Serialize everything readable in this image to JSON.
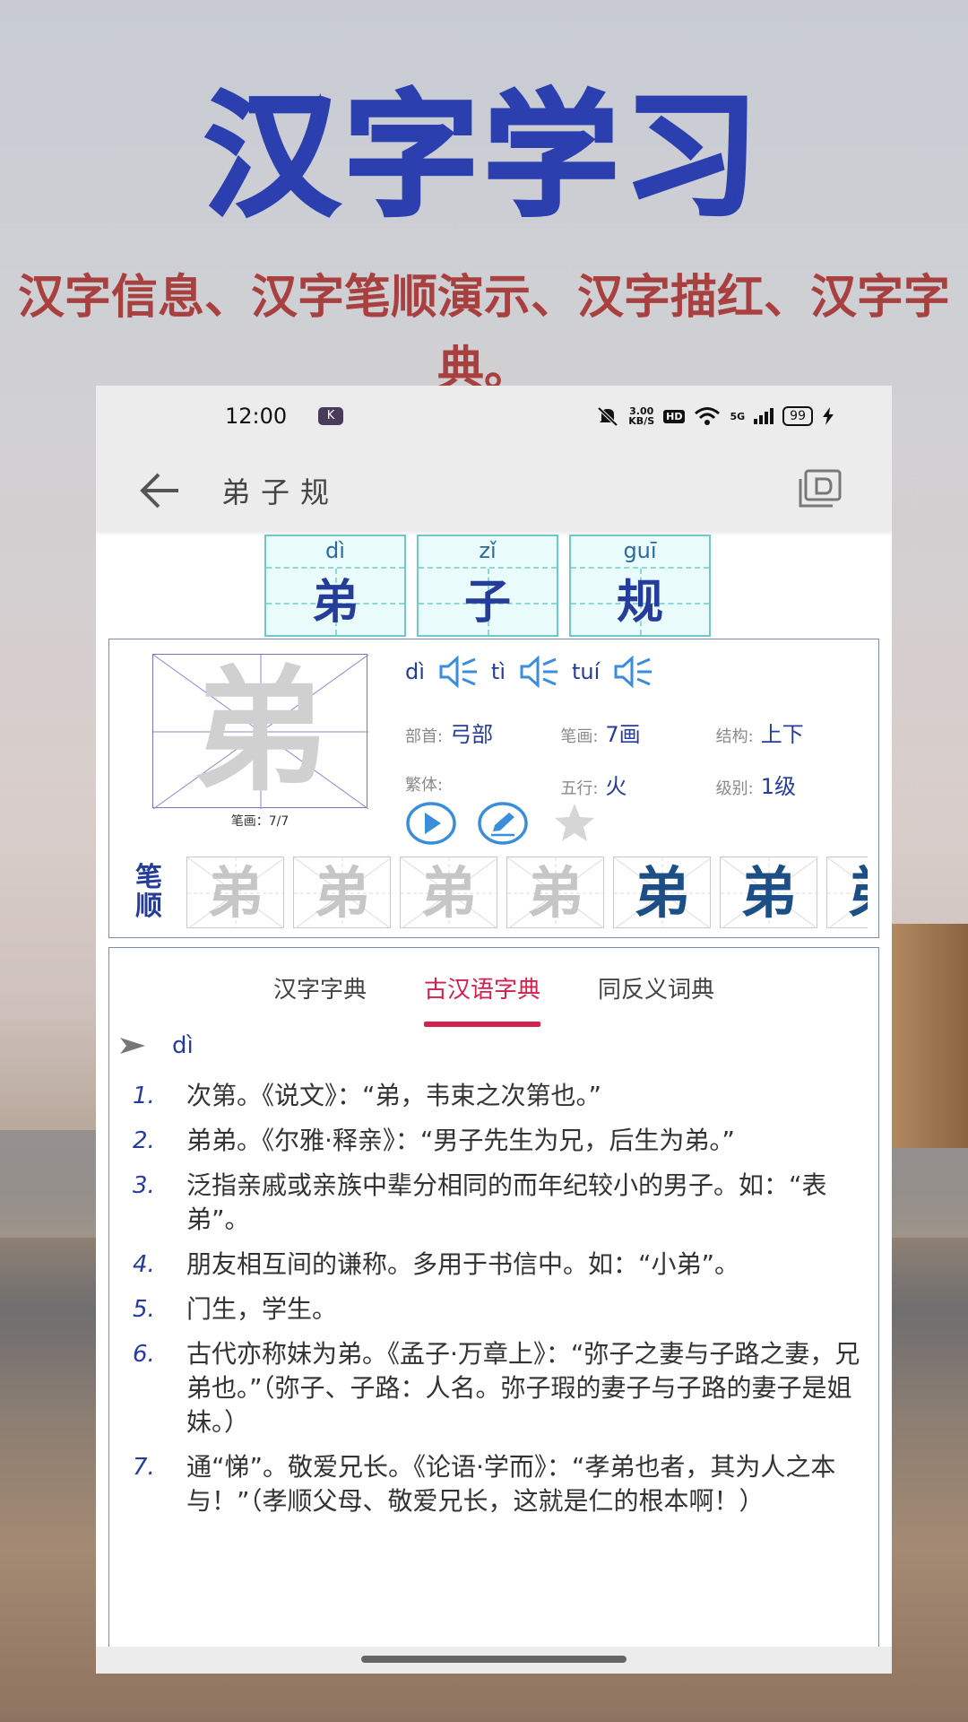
{
  "hero": {
    "title": "汉字学习",
    "subtitle": "汉字信息、汉字笔顺演示、汉字描红、汉字字典。"
  },
  "status_bar": {
    "time": "12:00",
    "k_badge": "K",
    "speed_value": "3.00",
    "speed_unit": "KB/S",
    "hd": "HD",
    "network": "5G",
    "battery": "99"
  },
  "app_bar": {
    "title": "弟子规",
    "back_icon": "arrow-left-icon",
    "right_icon": "book-icon"
  },
  "characters": [
    {
      "pinyin": "dì",
      "hanzi": "弟"
    },
    {
      "pinyin": "zǐ",
      "hanzi": "子"
    },
    {
      "pinyin": "guī",
      "hanzi": "规"
    }
  ],
  "detail": {
    "char": "弟",
    "stroke_progress": "笔画：7/7",
    "pronunciations": [
      "dì",
      "tì",
      "tuí"
    ],
    "attributes": [
      [
        {
          "label": "部首:",
          "value": "弓部"
        },
        {
          "label": "笔画:",
          "value": "7画"
        },
        {
          "label": "结构:",
          "value": "上下"
        }
      ],
      [
        {
          "label": "繁体:",
          "value": ""
        },
        {
          "label": "五行:",
          "value": "火"
        },
        {
          "label": "级别:",
          "value": "1级"
        }
      ]
    ],
    "stroke_order_label_1": "笔",
    "stroke_order_label_2": "顺",
    "stroke_order_count": 7,
    "stroke_order_shown": 7
  },
  "dict": {
    "tabs": [
      "汉字字典",
      "古汉语字典",
      "同反义词典"
    ],
    "active_tab": 1,
    "heading_pinyin": "dì",
    "definitions": [
      {
        "num": "1.",
        "text": "次第。《说文》：“弟，韦束之次第也。”"
      },
      {
        "num": "2.",
        "text": "弟弟。《尔雅·释亲》：“男子先生为兄，后生为弟。”"
      },
      {
        "num": "3.",
        "text": "泛指亲戚或亲族中辈分相同的而年纪较小的男子。如：“表弟”。"
      },
      {
        "num": "4.",
        "text": "朋友相互间的谦称。多用于书信中。如：“小弟”。"
      },
      {
        "num": "5.",
        "text": "门生，学生。"
      },
      {
        "num": "6.",
        "text": "古代亦称妹为弟。《孟子·万章上》：“弥子之妻与子路之妻，兄弟也。”（弥子、子路：人名。弥子瑕的妻子与子路的妻子是姐妹。）"
      },
      {
        "num": "7.",
        "text": "通“悌”。敬爱兄长。《论语·学而》：“孝弟也者，其为人之本与！”（孝顺父母、敬爱兄长，这就是仁的根本啊！）"
      }
    ]
  },
  "colors": {
    "accent_blue": "#263c9a",
    "hero_blue": "#2b3fae",
    "hero_red": "#a84040",
    "tab_active": "#d4214d",
    "box_teal": "#6fc9c9"
  }
}
